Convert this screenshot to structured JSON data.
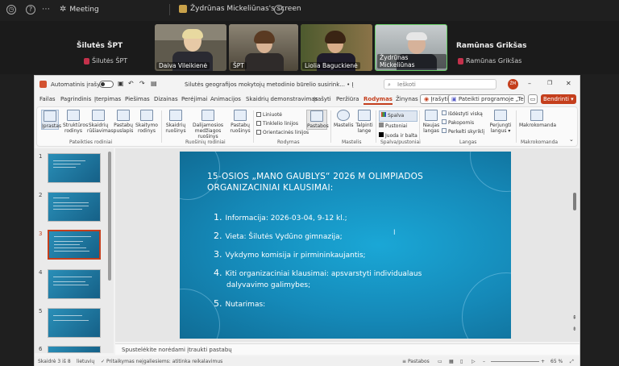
{
  "teams": {
    "meeting_label": "Meeting",
    "screen_share_label": "Žydrūnas Mickeliūnas's screen",
    "more_label": "⋯",
    "help_label": "?"
  },
  "participants": {
    "left_big_name": "Šilutės ŠPT",
    "left_small_name": "Šilutės ŠPT",
    "right_big_name": "Ramūnas Grikšas",
    "right_small_name": "Ramūnas Grikšas",
    "tiles": [
      {
        "label": "Daiva Vileikienė"
      },
      {
        "label": "ŠPT"
      },
      {
        "label": "Liolia Baguckienė"
      },
      {
        "label": "Žydrūnas Mickeliūnas"
      }
    ]
  },
  "ppt": {
    "autosave_label": "Automatinis įrašymas",
    "doc_title": "Šilutės geografijos mokytojų metodinio būrelio susirink... • Įrašyta į „Iš kompiuterio\" ▾",
    "search_placeholder": "Ieškoti",
    "user_initials": "ŽM",
    "tabs": [
      "Failas",
      "Pagrindinis",
      "Įterpimas",
      "Piešimas",
      "Dizainas",
      "Perėjimai",
      "Animacijos",
      "Skaidrių demonstravimas",
      "Įrašyti",
      "Peržiūra",
      "Rodymas",
      "Žinynas"
    ],
    "active_tab": "Rodymas",
    "record_btn": "Įrašyti",
    "teams_btn": "Pateikti programoje „Teams",
    "share_btn": "Bendrinti ▾",
    "ribbon": {
      "views": [
        "Įprastas",
        "Struktūros rodinys",
        "Skaidrių rūšiavimas",
        "Pastabų puslapis",
        "Skaitymo rodinys"
      ],
      "views_group": "Pateikties rodiniai",
      "masters": [
        "Skaidrių ruošinys",
        "Dalijamosios medžiagos ruošinys",
        "Pastabų ruošinys"
      ],
      "masters_group": "Ruošinių rodiniai",
      "show_checks": [
        "Liniuotė",
        "Tinklelio linijos",
        "Orientacinės linijos"
      ],
      "notes_btn": "Pastabos",
      "show_group": "Rodymas",
      "zoom_btns": [
        "Mastelis",
        "Talpinti lange"
      ],
      "zoom_group": "Mastelis",
      "color_opts": [
        "Spalva",
        "Pustoniai",
        "Juoda ir balta"
      ],
      "color_group": "Spalva/pustoniai",
      "window_btns": [
        "Naujas langas",
        "Išdėstyti viską",
        "Pakopomis",
        "Perkelti skyriklį"
      ],
      "window_group": "Langas",
      "switch_btn": "Perjungti langus ▾",
      "macros_btn": "Makrokomanda",
      "macros_group": "Makrokomanda"
    },
    "thumbnails": [
      "1",
      "2",
      "3",
      "4",
      "5",
      "6"
    ],
    "selected_thumb": "3",
    "slide": {
      "title_line1": "15-OSIOS „MANO GAUBLYS“ 2026 M OLIMPIADOS",
      "title_line2": "ORGANIZACINIAI KLAUSIMAI:",
      "items": [
        {
          "num": "1.",
          "text": "Informacija: 2026-03-04, 9-12 kl.;"
        },
        {
          "num": "2.",
          "text": "Vieta: Šilutės Vydūno gimnazija;"
        },
        {
          "num": "3.",
          "text": "Vykdymo komisija ir pirmininkaujantis;"
        },
        {
          "num": "4.",
          "text": "Kiti organizaciniai klausimai: apsvarstyti individualaus"
        },
        {
          "num": "",
          "text": "dalyvavimo galimybes;"
        },
        {
          "num": "5.",
          "text": "Nutarimas:"
        }
      ]
    },
    "notes_placeholder": "Spustelėkite norėdami įtraukti pastabų",
    "status": {
      "slide_counter": "Skaidrė 3 iš 8",
      "language": "lietuvių",
      "accessibility": "Pritaikymas neįgaliesiems: atitinka reikalavimus",
      "notes": "Pastabos",
      "zoom": "65 %"
    }
  }
}
